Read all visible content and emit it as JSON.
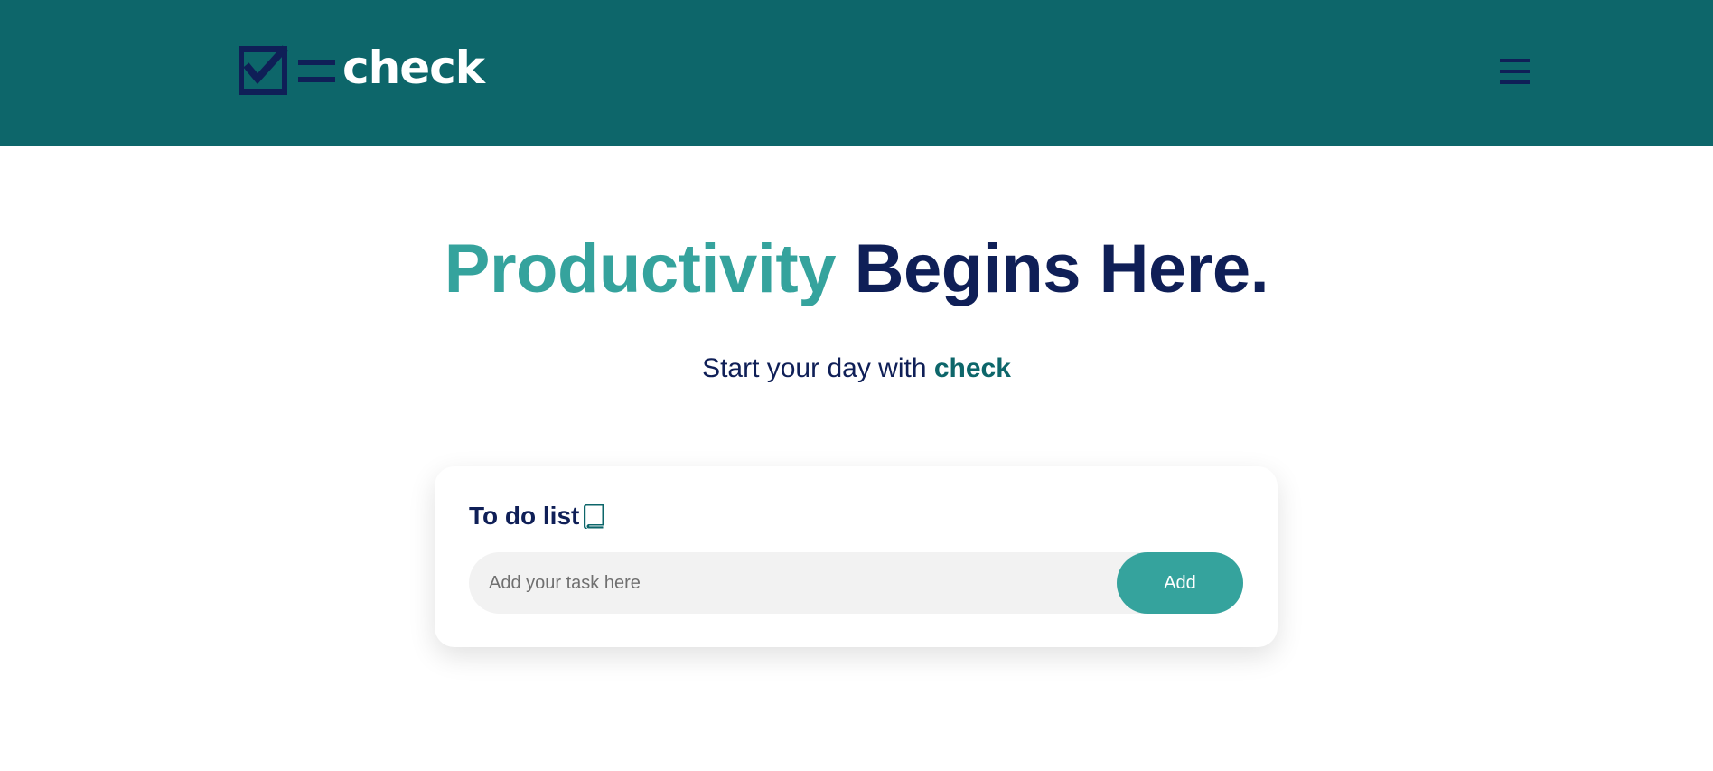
{
  "brand": {
    "logo_text": "check",
    "mark_icon": "checklist-logo-icon"
  },
  "header": {
    "menu_icon": "hamburger-menu-icon"
  },
  "hero": {
    "title_accent": "Productivity",
    "title_rest": "Begins Here.",
    "subtitle_prefix": "Start your day with",
    "subtitle_brand": "check"
  },
  "todo": {
    "title": "To do list",
    "title_icon": "book-icon",
    "input_placeholder": "Add your task here",
    "input_value": "",
    "add_button_label": "Add"
  },
  "colors": {
    "header_bg": "#0d666a",
    "accent": "#35a39d",
    "navy": "#0f1f57",
    "input_bg": "#f2f2f2",
    "page_bg": "#ffffff"
  }
}
